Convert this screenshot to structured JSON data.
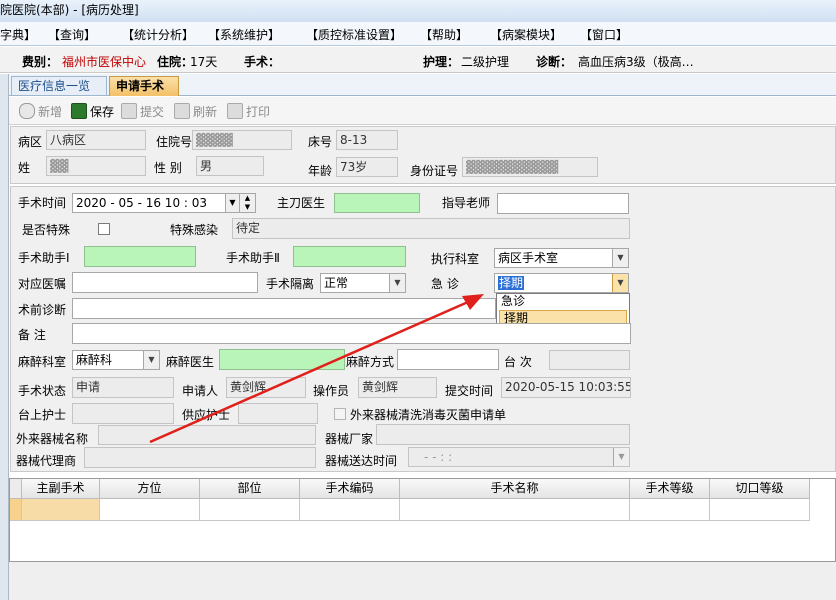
{
  "title": "院医院(本部) - [病历处理]",
  "menu": [
    "字典】",
    "【查询】",
    "【统计分析】",
    "【系统维护】",
    "【质控标准设置】",
    "【帮助】",
    "【病案模块】",
    "【窗口】"
  ],
  "info": {
    "dept_label": "费别：",
    "dept_value": "福州市医保中心",
    "stay_label": "住院：",
    "stay_value": "17天",
    "surgery_label": "手术：",
    "nursing_label": "护理：",
    "nursing_value": "二级护理",
    "diag_label": "诊断：",
    "diag_value": "高血压病3级（极高…"
  },
  "tabs": [
    "医疗信息一览表",
    "申请手术"
  ],
  "toolbar": [
    "新增",
    "保存",
    "提交",
    "刷新",
    "打印"
  ],
  "patient": {
    "ward_label": "病区",
    "ward_value": "八病区",
    "inpatient_label": "住院号",
    "inpatient_value": "▓▓▓▓",
    "bed_label": "床号",
    "bed_value": "8-13",
    "name_label": "姓",
    "name_value": "▓▓",
    "sex_label": "性  别",
    "sex_value": "男",
    "age_label": "年龄",
    "age_value": "73岁",
    "id_label": "身份证号",
    "id_value": "▓▓▓▓▓▓▓▓▓▓"
  },
  "form": {
    "surgery_time_label": "手术时间",
    "surgery_time_value": "2020 - 05 - 16    10 : 03",
    "surgeon_label": "主刀医生",
    "teacher_label": "指导老师",
    "special_label": "是否特殊",
    "infection_label": "特殊感染",
    "infection_value": "待定",
    "assistant1_label": "手术助手Ⅰ",
    "assistant2_label": "手术助手Ⅱ",
    "exec_dept_label": "执行科室",
    "exec_dept_value": "病区手术室",
    "order_label": "对应医嘱",
    "isolation_label": "手术隔离",
    "isolation_value": "正常",
    "urgent_label": "急    诊",
    "urgent_value": "择期",
    "preop_label": "术前诊断",
    "note_label": "备    注",
    "anes_dept_label": "麻醉科室",
    "anes_dept_value": "麻醉科",
    "anes_doc_label": "麻醉医生",
    "anes_method_label": "麻醉方式",
    "table_label": "台    次",
    "status_label": "手术状态",
    "status_value": "申请",
    "applicant_label": "申请人",
    "applicant_value": "黄剑辉",
    "operator_label": "操作员",
    "operator_value": "黄剑辉",
    "submit_label": "提交时间",
    "submit_value": "2020-05-15 10:03:55",
    "nurse_label": "台上护士",
    "supply_nurse_label": "供应护士",
    "external_clean_label": "外来器械清洗消毒灭菌申请单",
    "ext_name_label": "外来器械名称",
    "maker_label": "器械厂家",
    "agent_label": "器械代理商",
    "delivery_label": "器械送达时间",
    "delivery_value": "-    -           :      :"
  },
  "dropdown_options": [
    "急诊",
    "择期"
  ],
  "grid_headers": [
    "主副手术",
    "方位",
    "部位",
    "手术编码",
    "手术名称",
    "手术等级",
    "切口等级"
  ]
}
